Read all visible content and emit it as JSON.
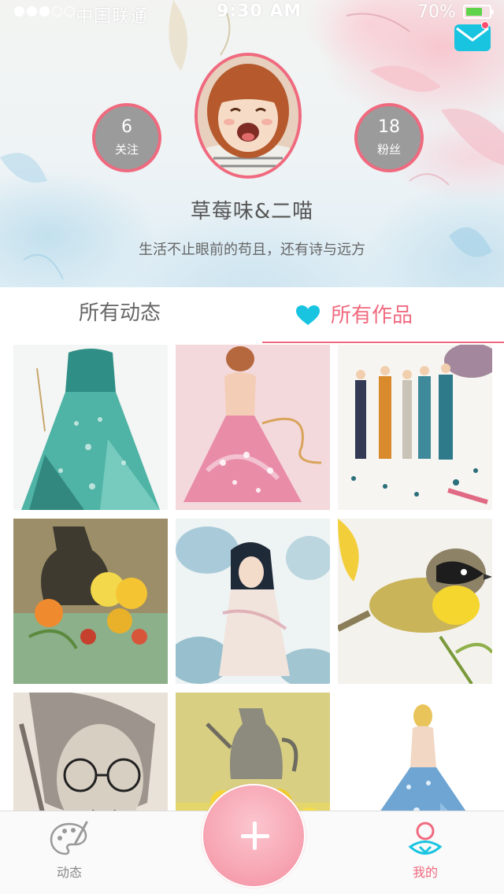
{
  "status_bar": {
    "signal_dots_filled": 3,
    "signal_dots_total": 5,
    "carrier": "中国联通",
    "time": "9:30 AM",
    "battery": "70%",
    "battery_level": 0.7
  },
  "header": {
    "mail_icon": "mail-icon",
    "mail_has_notification": true,
    "avatar_icon": "user-avatar",
    "following": {
      "count": "6",
      "label": "关注"
    },
    "followers": {
      "count": "18",
      "label": "粉丝"
    },
    "username": "草莓味&二喵",
    "bio": "生活不止眼前的苟且，还有诗与远方"
  },
  "tabs": {
    "all_posts": "所有动态",
    "all_works": "所有作品",
    "active": "all_works",
    "active_icon": "heart-icon"
  },
  "gallery": [
    {
      "name": "artwork-teal-gown"
    },
    {
      "name": "artwork-pink-gown-back"
    },
    {
      "name": "artwork-fashion-sketches"
    },
    {
      "name": "artwork-still-life-vase"
    },
    {
      "name": "artwork-watercolor-girl"
    },
    {
      "name": "artwork-yellow-bird"
    },
    {
      "name": "artwork-pencil-portrait"
    },
    {
      "name": "artwork-teapot-still-life"
    },
    {
      "name": "artwork-blue-dress"
    }
  ],
  "bottom_nav": {
    "feed": {
      "label": "动态",
      "icon": "palette-icon"
    },
    "add": {
      "icon": "plus-icon"
    },
    "mine": {
      "label": "我的",
      "icon": "profile-icon"
    }
  },
  "colors": {
    "accent_pink": "#f06a7f",
    "accent_cyan": "#19c4e0",
    "text_gray": "#666666"
  }
}
